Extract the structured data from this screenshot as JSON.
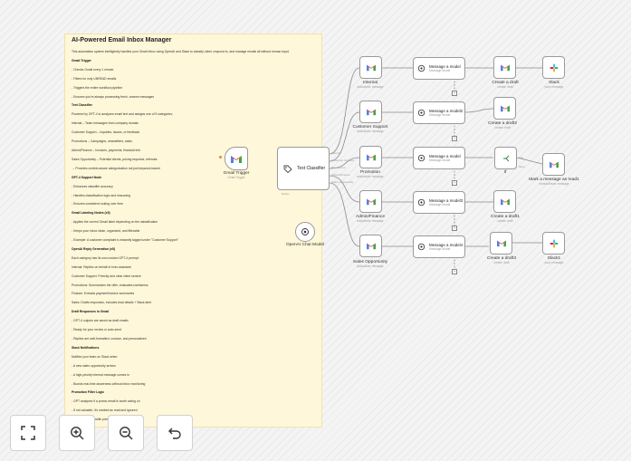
{
  "sticky": {
    "title": "AI-Powered Email Inbox Manager",
    "lines": [
      {
        "t": "This automation system intelligently handles your Gmail inbox using OpenAI and Slack to classify, label, respond to, and manage emails all without human input.",
        "h": false
      },
      {
        "t": "Gmail Trigger",
        "h": true
      },
      {
        "t": "- Checks Gmail every 1 minute",
        "h": false
      },
      {
        "t": "- Filters for only UNREAD emails",
        "h": false
      },
      {
        "t": "- Triggers the entire workflow pipeline",
        "h": false
      },
      {
        "t": "- Ensures you're always processing fresh, unseen messages",
        "h": false
      },
      {
        "t": "Text Classifier",
        "h": true
      },
      {
        "t": "Powered by GPT-4 to analyzes email text and assigns one of 5 categories:",
        "h": false
      },
      {
        "t": "Internal – Team messages from company domain",
        "h": false
      },
      {
        "t": "Customer Support – Inquiries, issues, or feedback",
        "h": false
      },
      {
        "t": "Promotions – Campaigns, newsletters, sales",
        "h": false
      },
      {
        "t": "Admin/Finance – Invoices, payments, financial info",
        "h": false
      },
      {
        "t": "Sales Opportunity – Potential clients, pricing requests, referrals",
        "h": false
      },
      {
        "t": "→ Provides context-aware categorization not just keyword-based",
        "h": false
      },
      {
        "t": "GPT-4 Support Node",
        "h": true
      },
      {
        "t": "- Enhances classifier accuracy",
        "h": false
      },
      {
        "t": "- Handles classification logic and reasoning",
        "h": false
      },
      {
        "t": "- Ensures consistent routing over time",
        "h": false
      },
      {
        "t": "Gmail Labeling Nodes (x5)",
        "h": true
      },
      {
        "t": "- Applies the correct Gmail label depending on the classification",
        "h": false
      },
      {
        "t": "- Keeps your inbox clean, organized, and filterable",
        "h": false
      },
      {
        "t": "- Example: A customer complaint is instantly tagged under \"Customer Support\"",
        "h": false
      },
      {
        "t": "OpenAI Reply Generation (x5)",
        "h": true
      },
      {
        "t": "Each category has its own custom GPT-4 prompt:",
        "h": false
      },
      {
        "t": "Internal: Replies on behalf of exec assistant",
        "h": false
      },
      {
        "t": "Customer Support: Friendly and clear client service",
        "h": false
      },
      {
        "t": "Promotions: Summarizes the offer, evaluates usefulness",
        "h": false
      },
      {
        "t": "Finance: Extracts payment/invoice summaries",
        "h": false
      },
      {
        "t": "Sales: Drafts responses, includes lead details + Slack alert",
        "h": false
      },
      {
        "t": "Draft Responses in Gmail",
        "h": true
      },
      {
        "t": "- GPT-4 outputs are saved as draft emails",
        "h": false
      },
      {
        "t": "- Ready for your review or auto-send",
        "h": false
      },
      {
        "t": "- Replies are well-formatted, concise, and personalized",
        "h": false
      },
      {
        "t": "Slack Notifications",
        "h": true
      },
      {
        "t": "Notifies your team on Slack when:",
        "h": false
      },
      {
        "t": "- A new sales opportunity arrives",
        "h": false
      },
      {
        "t": "- A high-priority internal message comes in",
        "h": false
      },
      {
        "t": "- Boosts real-time awareness without inbox monitoring",
        "h": false
      },
      {
        "t": "Promotion Filter Logic",
        "h": true
      },
      {
        "t": "- GPT analyzes if a promo email is worth acting on",
        "h": false
      },
      {
        "t": "- If not valuable, it's marked as read and ignored",
        "h": false
      },
      {
        "t": "- Reduces noise while preserving opportunities",
        "h": false
      }
    ]
  },
  "nodes": {
    "gmail_trigger": {
      "title": "Gmail Trigger",
      "sub": "Gmail Trigger"
    },
    "text_classifier": {
      "title": "Text Classifier",
      "input": "Model"
    },
    "openai_chat_model": {
      "title": "OpenAI Chat Model"
    },
    "internal": {
      "title": "Internal",
      "sub": "addLabels: message"
    },
    "customer_support": {
      "title": "Customer Support",
      "sub": "addLabels: message"
    },
    "promotion": {
      "title": "Promotion",
      "sub": "addLabels: message"
    },
    "admin_finance": {
      "title": "Admin/Finance",
      "sub": "addLabels: message"
    },
    "sales_opportunity": {
      "title": "Sales Opportunity",
      "sub": "addLabels: message"
    },
    "msg_model": {
      "title": "Message a model",
      "sub": "Message Model"
    },
    "msg_model2": {
      "title": "Message a model2",
      "sub": "Message Model"
    },
    "msg_model_promo": {
      "title": "Message a model",
      "sub": "Message Model"
    },
    "msg_model3": {
      "title": "Message a model3",
      "sub": "Message Model"
    },
    "msg_model4": {
      "title": "Message a model4",
      "sub": "Message Model"
    },
    "create_draft": {
      "title": "Create a draft",
      "sub": "create: draft"
    },
    "create_draft2": {
      "title": "Create a draft2",
      "sub": "create: draft"
    },
    "if_node": {
      "title": "If"
    },
    "create_draft1": {
      "title": "Create a draft1",
      "sub": "create: draft"
    },
    "create_draft3": {
      "title": "Create a draft3",
      "sub": "create: draft"
    },
    "mark_read": {
      "title": "Mark a message as read1",
      "sub": "markAsRead: message"
    },
    "slack": {
      "title": "Slack",
      "sub": "post: message"
    },
    "slack1": {
      "title": "Slack1",
      "sub": "post: message"
    }
  },
  "edge_labels": {
    "internal": "Internal",
    "customer_support": "Customer Support",
    "promotions": "Promotions",
    "admin_finance": "Admin/Finance",
    "sales_opportunity": "Sales Opportunity",
    "true": "true",
    "false": "false",
    "model": "Model",
    "tools": "Tools"
  },
  "toolbar": {
    "fit": "fit-view",
    "zoom_in": "zoom-in",
    "zoom_out": "zoom-out",
    "undo": "undo"
  },
  "colors": {
    "gmail_red": "#ea4335",
    "gmail_blue": "#4285f4",
    "gmail_green": "#34a853",
    "gmail_yellow": "#fbbc04",
    "sticky_bg": "#fff7d9",
    "edge": "#8a8a8a"
  }
}
